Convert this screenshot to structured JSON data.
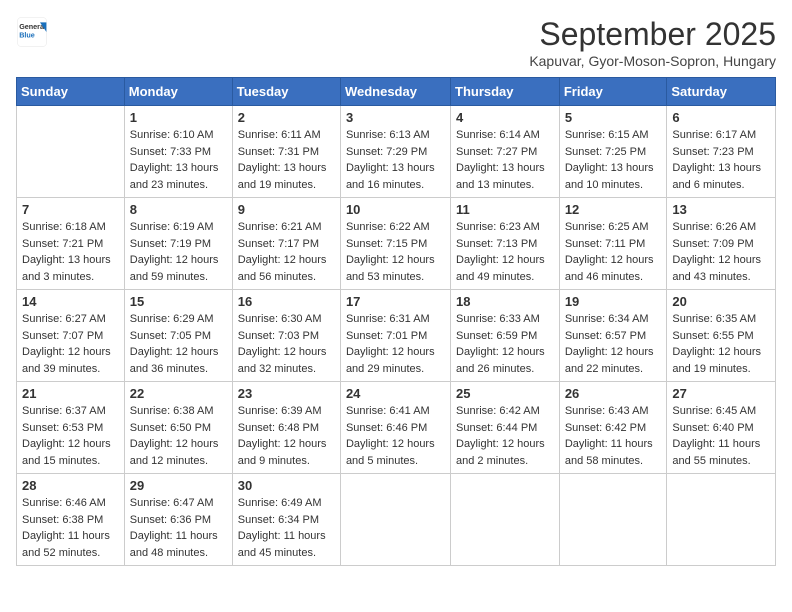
{
  "header": {
    "logo_general": "General",
    "logo_blue": "Blue",
    "month": "September 2025",
    "location": "Kapuvar, Gyor-Moson-Sopron, Hungary"
  },
  "days_of_week": [
    "Sunday",
    "Monday",
    "Tuesday",
    "Wednesday",
    "Thursday",
    "Friday",
    "Saturday"
  ],
  "weeks": [
    [
      {
        "day": "",
        "info": ""
      },
      {
        "day": "1",
        "info": "Sunrise: 6:10 AM\nSunset: 7:33 PM\nDaylight: 13 hours\nand 23 minutes."
      },
      {
        "day": "2",
        "info": "Sunrise: 6:11 AM\nSunset: 7:31 PM\nDaylight: 13 hours\nand 19 minutes."
      },
      {
        "day": "3",
        "info": "Sunrise: 6:13 AM\nSunset: 7:29 PM\nDaylight: 13 hours\nand 16 minutes."
      },
      {
        "day": "4",
        "info": "Sunrise: 6:14 AM\nSunset: 7:27 PM\nDaylight: 13 hours\nand 13 minutes."
      },
      {
        "day": "5",
        "info": "Sunrise: 6:15 AM\nSunset: 7:25 PM\nDaylight: 13 hours\nand 10 minutes."
      },
      {
        "day": "6",
        "info": "Sunrise: 6:17 AM\nSunset: 7:23 PM\nDaylight: 13 hours\nand 6 minutes."
      }
    ],
    [
      {
        "day": "7",
        "info": "Sunrise: 6:18 AM\nSunset: 7:21 PM\nDaylight: 13 hours\nand 3 minutes."
      },
      {
        "day": "8",
        "info": "Sunrise: 6:19 AM\nSunset: 7:19 PM\nDaylight: 12 hours\nand 59 minutes."
      },
      {
        "day": "9",
        "info": "Sunrise: 6:21 AM\nSunset: 7:17 PM\nDaylight: 12 hours\nand 56 minutes."
      },
      {
        "day": "10",
        "info": "Sunrise: 6:22 AM\nSunset: 7:15 PM\nDaylight: 12 hours\nand 53 minutes."
      },
      {
        "day": "11",
        "info": "Sunrise: 6:23 AM\nSunset: 7:13 PM\nDaylight: 12 hours\nand 49 minutes."
      },
      {
        "day": "12",
        "info": "Sunrise: 6:25 AM\nSunset: 7:11 PM\nDaylight: 12 hours\nand 46 minutes."
      },
      {
        "day": "13",
        "info": "Sunrise: 6:26 AM\nSunset: 7:09 PM\nDaylight: 12 hours\nand 43 minutes."
      }
    ],
    [
      {
        "day": "14",
        "info": "Sunrise: 6:27 AM\nSunset: 7:07 PM\nDaylight: 12 hours\nand 39 minutes."
      },
      {
        "day": "15",
        "info": "Sunrise: 6:29 AM\nSunset: 7:05 PM\nDaylight: 12 hours\nand 36 minutes."
      },
      {
        "day": "16",
        "info": "Sunrise: 6:30 AM\nSunset: 7:03 PM\nDaylight: 12 hours\nand 32 minutes."
      },
      {
        "day": "17",
        "info": "Sunrise: 6:31 AM\nSunset: 7:01 PM\nDaylight: 12 hours\nand 29 minutes."
      },
      {
        "day": "18",
        "info": "Sunrise: 6:33 AM\nSunset: 6:59 PM\nDaylight: 12 hours\nand 26 minutes."
      },
      {
        "day": "19",
        "info": "Sunrise: 6:34 AM\nSunset: 6:57 PM\nDaylight: 12 hours\nand 22 minutes."
      },
      {
        "day": "20",
        "info": "Sunrise: 6:35 AM\nSunset: 6:55 PM\nDaylight: 12 hours\nand 19 minutes."
      }
    ],
    [
      {
        "day": "21",
        "info": "Sunrise: 6:37 AM\nSunset: 6:53 PM\nDaylight: 12 hours\nand 15 minutes."
      },
      {
        "day": "22",
        "info": "Sunrise: 6:38 AM\nSunset: 6:50 PM\nDaylight: 12 hours\nand 12 minutes."
      },
      {
        "day": "23",
        "info": "Sunrise: 6:39 AM\nSunset: 6:48 PM\nDaylight: 12 hours\nand 9 minutes."
      },
      {
        "day": "24",
        "info": "Sunrise: 6:41 AM\nSunset: 6:46 PM\nDaylight: 12 hours\nand 5 minutes."
      },
      {
        "day": "25",
        "info": "Sunrise: 6:42 AM\nSunset: 6:44 PM\nDaylight: 12 hours\nand 2 minutes."
      },
      {
        "day": "26",
        "info": "Sunrise: 6:43 AM\nSunset: 6:42 PM\nDaylight: 11 hours\nand 58 minutes."
      },
      {
        "day": "27",
        "info": "Sunrise: 6:45 AM\nSunset: 6:40 PM\nDaylight: 11 hours\nand 55 minutes."
      }
    ],
    [
      {
        "day": "28",
        "info": "Sunrise: 6:46 AM\nSunset: 6:38 PM\nDaylight: 11 hours\nand 52 minutes."
      },
      {
        "day": "29",
        "info": "Sunrise: 6:47 AM\nSunset: 6:36 PM\nDaylight: 11 hours\nand 48 minutes."
      },
      {
        "day": "30",
        "info": "Sunrise: 6:49 AM\nSunset: 6:34 PM\nDaylight: 11 hours\nand 45 minutes."
      },
      {
        "day": "",
        "info": ""
      },
      {
        "day": "",
        "info": ""
      },
      {
        "day": "",
        "info": ""
      },
      {
        "day": "",
        "info": ""
      }
    ]
  ]
}
